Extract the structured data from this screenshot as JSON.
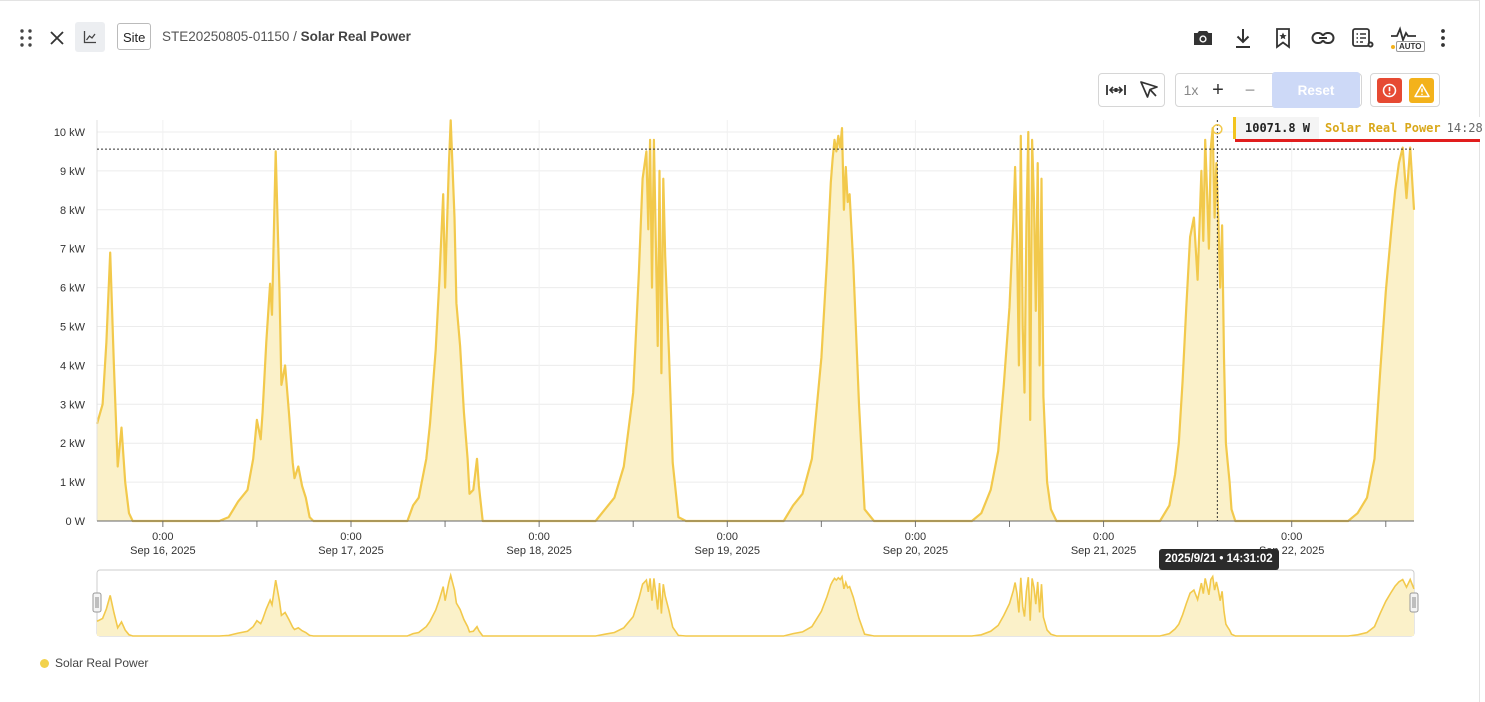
{
  "header": {
    "site_label": "Site",
    "breadcrumb_id": "STE20250805-01150",
    "breadcrumb_sep": " / ",
    "breadcrumb_title": "Solar Real Power",
    "auto_badge": "AUTO"
  },
  "toolbar": {
    "zoom_level": "1x",
    "zoom_in": "+",
    "zoom_out": "−",
    "reset_label": "Reset"
  },
  "tooltip": {
    "value": "10071.8 W",
    "series": "Solar Real Power",
    "time": "14:28",
    "x_readout": "2025/9/21 • 14:31:02"
  },
  "legend": {
    "label": "Solar Real Power"
  },
  "colors": {
    "series_line": "#f2c94c",
    "series_fill": "#fbf1c9",
    "reset_bg": "#cdd9f7",
    "alert_red": "#e64a33",
    "alert_amber": "#f3b21b"
  },
  "chart_data": {
    "type": "area",
    "series": [
      {
        "name": "Solar Real Power",
        "color": "#f2c94c"
      }
    ],
    "ylim": [
      0,
      10.2
    ],
    "y_unit": "kW",
    "yticks": [
      0,
      1,
      2,
      3,
      4,
      5,
      6,
      7,
      8,
      9,
      10
    ],
    "ytick_labels": [
      "0 W",
      "1 kW",
      "2 kW",
      "3 kW",
      "4 kW",
      "5 kW",
      "6 kW",
      "7 kW",
      "8 kW",
      "9 kW",
      "10 kW"
    ],
    "xlim_days": [
      -0.35,
      6.65
    ],
    "xticks": [
      {
        "day": 0,
        "time": "0:00",
        "date": "Sep 16, 2025"
      },
      {
        "day": 1,
        "time": "0:00",
        "date": "Sep 17, 2025"
      },
      {
        "day": 2,
        "time": "0:00",
        "date": "Sep 18, 2025"
      },
      {
        "day": 3,
        "time": "0:00",
        "date": "Sep 19, 2025"
      },
      {
        "day": 4,
        "time": "0:00",
        "date": "Sep 20, 2025"
      },
      {
        "day": 5,
        "time": "0:00",
        "date": "Sep 21, 2025"
      },
      {
        "day": 6,
        "time": "0:00",
        "date": "Sep 22, 2025"
      }
    ],
    "crosshair": {
      "day": 5.6048,
      "value": 9.56
    },
    "x": [
      -0.35,
      -0.32,
      -0.3,
      -0.28,
      -0.26,
      -0.24,
      -0.22,
      -0.2,
      -0.18,
      -0.16,
      -0.14,
      -0.12,
      -0.1,
      -0.08,
      0.3,
      0.35,
      0.4,
      0.45,
      0.48,
      0.5,
      0.52,
      0.53,
      0.55,
      0.57,
      0.58,
      0.6,
      0.62,
      0.63,
      0.65,
      0.67,
      0.69,
      0.7,
      0.72,
      0.74,
      0.76,
      0.78,
      0.8,
      0.82,
      0.84,
      0.87,
      1.3,
      1.33,
      1.36,
      1.4,
      1.42,
      1.45,
      1.47,
      1.49,
      1.5,
      1.52,
      1.53,
      1.55,
      1.56,
      1.58,
      1.6,
      1.62,
      1.63,
      1.65,
      1.67,
      1.68,
      1.7,
      1.74,
      1.77,
      1.8,
      1.83,
      1.86,
      2.3,
      2.35,
      2.4,
      2.45,
      2.5,
      2.53,
      2.55,
      2.57,
      2.58,
      2.59,
      2.6,
      2.61,
      2.62,
      2.63,
      2.64,
      2.65,
      2.66,
      2.67,
      2.69,
      2.71,
      2.74,
      2.78,
      3.3,
      3.35,
      3.4,
      3.45,
      3.5,
      3.53,
      3.55,
      3.56,
      3.57,
      3.58,
      3.59,
      3.6,
      3.61,
      3.62,
      3.63,
      3.64,
      3.65,
      3.67,
      3.7,
      3.73,
      3.78,
      4.3,
      4.35,
      4.4,
      4.44,
      4.47,
      4.5,
      4.52,
      4.53,
      4.54,
      4.55,
      4.56,
      4.57,
      4.58,
      4.59,
      4.6,
      4.61,
      4.62,
      4.63,
      4.64,
      4.65,
      4.66,
      4.67,
      4.68,
      4.7,
      4.72,
      4.75,
      4.79,
      5.3,
      5.35,
      5.38,
      5.4,
      5.42,
      5.44,
      5.46,
      5.48,
      5.5,
      5.52,
      5.53,
      5.54,
      5.55,
      5.56,
      5.57,
      5.58,
      5.59,
      5.6,
      5.61,
      5.62,
      5.63,
      5.64,
      5.65,
      5.66,
      5.67,
      5.68,
      5.7,
      5.72,
      5.74,
      5.76,
      5.8,
      6.3,
      6.35,
      6.4,
      6.44,
      6.47,
      6.5,
      6.53,
      6.55,
      6.57,
      6.59,
      6.61,
      6.63,
      6.65
    ],
    "y": [
      2.5,
      3.0,
      4.6,
      6.9,
      4.0,
      1.4,
      2.4,
      1.0,
      0.2,
      0,
      0,
      0,
      0,
      0,
      0,
      0.1,
      0.5,
      0.8,
      1.6,
      2.6,
      2.1,
      2.8,
      4.6,
      6.1,
      5.3,
      9.5,
      5.9,
      3.5,
      4.0,
      2.8,
      1.5,
      1.1,
      1.4,
      0.9,
      0.6,
      0.1,
      0,
      0,
      0,
      0,
      0,
      0.4,
      0.6,
      1.6,
      2.5,
      4.4,
      6.2,
      8.4,
      6.0,
      9.1,
      10.3,
      7.8,
      5.6,
      4.5,
      2.8,
      1.6,
      0.7,
      0.8,
      1.6,
      0.9,
      0,
      0,
      0,
      0,
      0,
      0,
      0,
      0.3,
      0.6,
      1.4,
      3.3,
      6.4,
      8.8,
      9.5,
      7.5,
      9.8,
      6.0,
      9.8,
      7.2,
      4.5,
      9.0,
      3.8,
      8.8,
      6.8,
      4.3,
      1.5,
      0.1,
      0,
      0,
      0.4,
      0.7,
      1.6,
      4.2,
      6.7,
      8.7,
      9.3,
      9.8,
      9.5,
      9.9,
      9.6,
      10.1,
      8.0,
      9.1,
      8.2,
      8.4,
      6.6,
      3.0,
      0.3,
      0,
      0,
      0.2,
      0.8,
      1.8,
      3.5,
      5.5,
      7.7,
      9.1,
      7.2,
      4.0,
      9.9,
      5.0,
      3.3,
      7.6,
      10.0,
      2.6,
      9.8,
      8.2,
      5.4,
      9.2,
      4.0,
      8.8,
      3.2,
      1.0,
      0.3,
      0,
      0,
      0,
      0.4,
      1.2,
      2.0,
      3.6,
      5.5,
      7.3,
      7.8,
      6.2,
      9.0,
      7.2,
      9.8,
      8.5,
      7.0,
      9.6,
      10.1,
      7.8,
      9.2,
      7.8,
      6.0,
      7.6,
      4.2,
      2.0,
      1.5,
      1.0,
      0.3,
      0,
      0,
      0,
      0,
      0,
      0,
      0.2,
      0.6,
      1.6,
      3.8,
      5.9,
      7.5,
      8.5,
      9.2,
      9.6,
      8.3,
      9.6,
      8.0
    ]
  }
}
